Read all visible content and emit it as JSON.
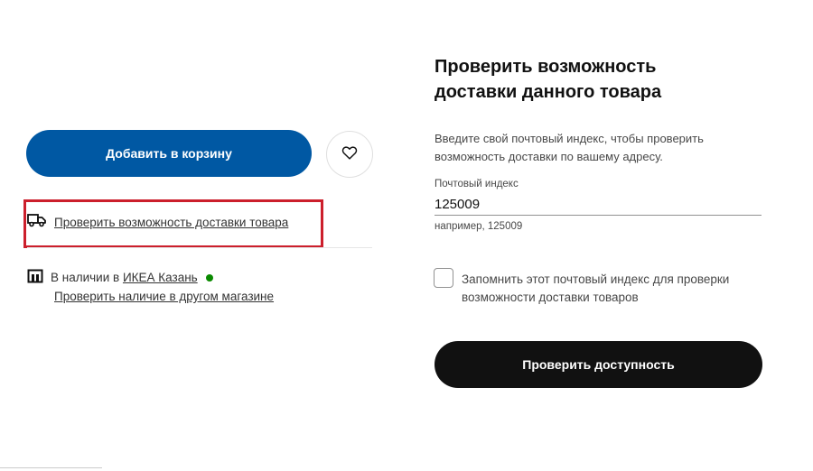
{
  "left": {
    "add_to_cart": "Добавить в корзину",
    "favorite_icon": "heart-icon",
    "delivery_icon": "truck-icon",
    "delivery_link": "Проверить возможность доставки товара",
    "stock_icon": "store-icon",
    "stock_prefix": "В наличии в",
    "stock_store": "ИКЕА Казань",
    "stock_status_color": "#0a8a00",
    "other_store_link": "Проверить наличие в другом магазине",
    "highlight_color": "#cc1f2c",
    "brand_color": "#0058a3"
  },
  "panel": {
    "title": "Проверить возможность доставки данного товара",
    "description": "Введите свой почтовый индекс, чтобы проверить возможность доставки по вашему адресу.",
    "zip_label": "Почтовый индекс",
    "zip_value": "125009",
    "zip_hint": "например, 125009",
    "remember_label": "Запомнить этот почтовый индекс для проверки возможности доставки товаров",
    "check_button": "Проверить доступность"
  }
}
